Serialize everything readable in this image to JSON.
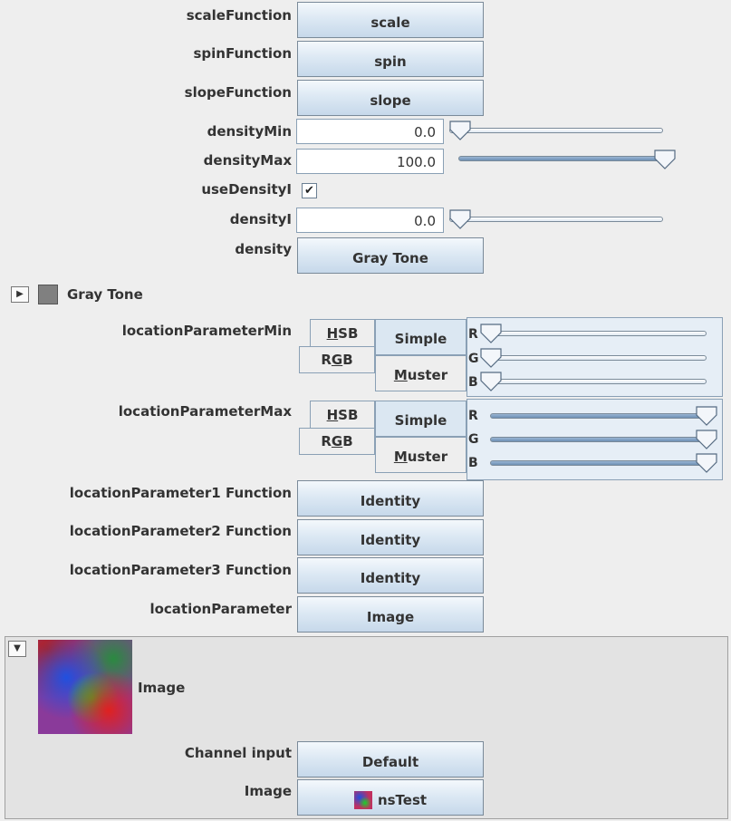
{
  "functions": {
    "scale_label": "scaleFunction",
    "scale_button": "scale",
    "spin_label": "spinFunction",
    "spin_button": "spin",
    "slope_label": "slopeFunction",
    "slope_button": "slope"
  },
  "density": {
    "min_label": "densityMin",
    "min_value": "0.0",
    "min_fraction": 0.0,
    "max_label": "densityMax",
    "max_value": "100.0",
    "max_fraction": 1.0,
    "use_label": "useDensityI",
    "use_checked": "✔",
    "densityi_label": "densityI",
    "densityi_value": "0.0",
    "densityi_fraction": 0.0,
    "density_label": "density",
    "density_button": "Gray Tone"
  },
  "gray_section": {
    "title": "Gray Tone",
    "swatch_color": "#808080"
  },
  "location_min": {
    "label": "locationParameterMin",
    "tab_hsb_pre": "",
    "tab_hsb_u": "H",
    "tab_hsb_post": "SB",
    "tab_rgb_pre": "R",
    "tab_rgb_u": "G",
    "tab_rgb_post": "B",
    "tab_simple": "Simple",
    "tab_muster_u": "M",
    "tab_muster_post": "uster",
    "r_label": "R",
    "g_label": "G",
    "b_label": "B",
    "r_fraction": 0.0,
    "g_fraction": 0.0,
    "b_fraction": 0.0
  },
  "location_max": {
    "label": "locationParameterMax",
    "tab_hsb_u": "H",
    "tab_hsb_post": "SB",
    "tab_rgb_pre": "R",
    "tab_rgb_u": "G",
    "tab_rgb_post": "B",
    "tab_simple": "Simple",
    "tab_muster_u": "M",
    "tab_muster_post": "uster",
    "r_label": "R",
    "g_label": "G",
    "b_label": "B",
    "r_fraction": 1.0,
    "g_fraction": 1.0,
    "b_fraction": 1.0
  },
  "location_functions": {
    "f1_label": "locationParameter1 Function",
    "f1_button": "Identity",
    "f2_label": "locationParameter2 Function",
    "f2_button": "Identity",
    "f3_label": "locationParameter3 Function",
    "f3_button": "Identity",
    "param_label": "locationParameter",
    "param_button": "Image"
  },
  "image_section": {
    "title": "Image",
    "channel_label": "Channel input",
    "channel_button": "Default",
    "image_label": "Image",
    "image_button": "nsTest"
  },
  "colors": {
    "button_border": "#7a8a99",
    "tab_selected": "#dbe7f2",
    "lower_bg": "#e3e3e3"
  }
}
